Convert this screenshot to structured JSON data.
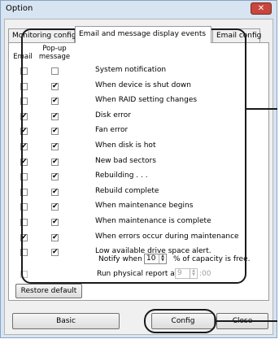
{
  "window": {
    "title": "Option",
    "close_glyph": "✕",
    "close_color": "#c9463d"
  },
  "tabs": [
    {
      "label": "Monitoring config",
      "active": false
    },
    {
      "label": "Email and message display events",
      "active": true
    },
    {
      "label": "Email config",
      "active": false
    }
  ],
  "columns": {
    "email": "Email",
    "popup_line1": "Pop-up",
    "popup_line2": "message"
  },
  "events": [
    {
      "label": "System notification",
      "email": false,
      "popup": false
    },
    {
      "label": "When device is shut down",
      "email": false,
      "popup": true
    },
    {
      "label": "When RAID setting changes",
      "email": false,
      "popup": true
    },
    {
      "label": "Disk error",
      "email": true,
      "popup": true
    },
    {
      "label": "Fan error",
      "email": true,
      "popup": true
    },
    {
      "label": "When disk is hot",
      "email": true,
      "popup": true
    },
    {
      "label": "New bad sectors",
      "email": true,
      "popup": true
    },
    {
      "label": "Rebuilding . . .",
      "email": false,
      "popup": true
    },
    {
      "label": "Rebuild complete",
      "email": false,
      "popup": true
    },
    {
      "label": "When maintenance begins",
      "email": false,
      "popup": true
    },
    {
      "label": "When maintenance is complete",
      "email": false,
      "popup": true
    },
    {
      "label": "When errors occur during maintenance",
      "email": true,
      "popup": true
    },
    {
      "label": "Low available drive space alert.",
      "email": false,
      "popup": true
    }
  ],
  "notify": {
    "prefix": "Notify when",
    "value": "10",
    "suffix": "% of capacity is free."
  },
  "physical_report": {
    "label": "Run physical report at",
    "checked": false,
    "hour": "9",
    "minute": ":00"
  },
  "buttons": {
    "restore_default": "Restore default",
    "basic": "Basic",
    "config": "Config",
    "close": "Close"
  },
  "check_glyph": "✔"
}
